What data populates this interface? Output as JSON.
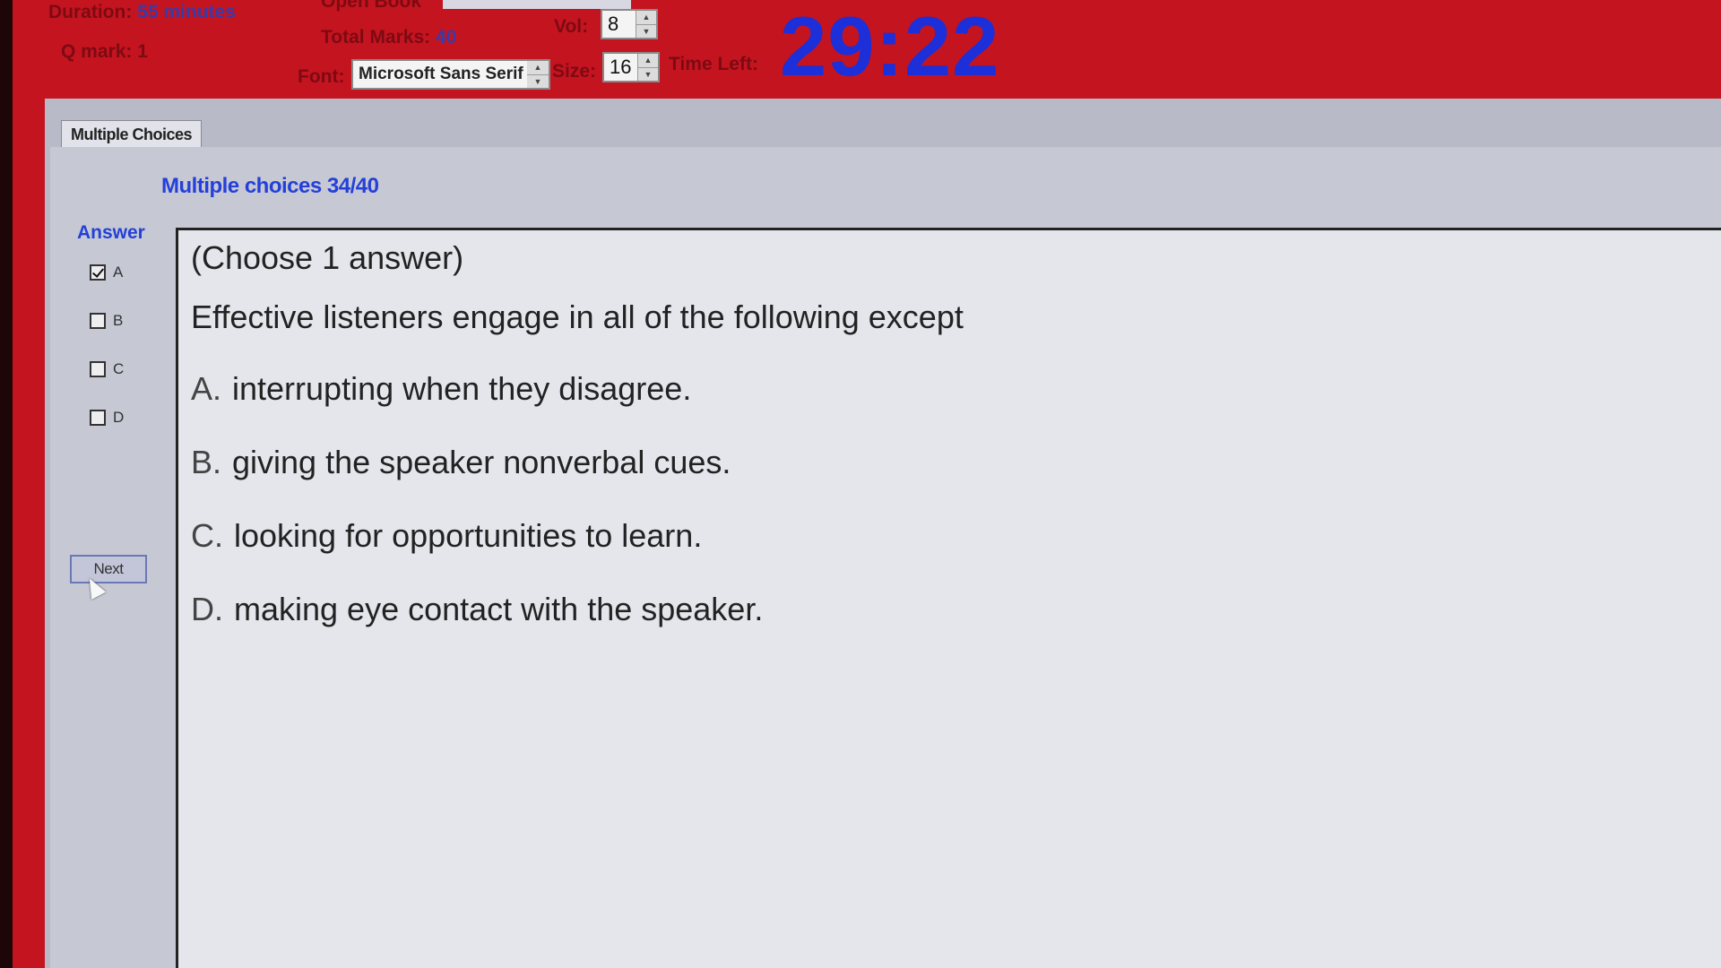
{
  "header": {
    "duration_label": "Duration:",
    "duration_value": "55 minutes",
    "qmark_label": "Q mark:",
    "qmark_value": "1",
    "open_book_label": "Open Book",
    "total_marks_label": "Total Marks:",
    "total_marks_value": "40",
    "vol_label": "Vol:",
    "vol_value": "8",
    "font_label": "Font:",
    "font_value": "Microsoft Sans Serif",
    "size_label": "Size:",
    "size_value": "16",
    "time_left_label": "Time Left:",
    "time_left_value": "29:22"
  },
  "tab": {
    "label": "Multiple Choices"
  },
  "section": {
    "title": "Multiple choices 34/40"
  },
  "answer_panel": {
    "label": "Answer",
    "choices": [
      {
        "letter": "A",
        "checked": true
      },
      {
        "letter": "B",
        "checked": false
      },
      {
        "letter": "C",
        "checked": false
      },
      {
        "letter": "D",
        "checked": false
      }
    ],
    "next_label": "Next"
  },
  "question": {
    "instruction": "(Choose 1 answer)",
    "stem": "Effective listeners engage in all of the following except",
    "options": [
      {
        "letter": "A.",
        "text": "interrupting when they disagree."
      },
      {
        "letter": "B.",
        "text": "giving the speaker nonverbal cues."
      },
      {
        "letter": "C.",
        "text": "looking for opportunities to learn."
      },
      {
        "letter": "D.",
        "text": "making eye contact with the speaker."
      }
    ]
  },
  "colors": {
    "header_bg": "#c41420",
    "timer": "#1d2fd8",
    "accent_blue": "#2440d8"
  }
}
